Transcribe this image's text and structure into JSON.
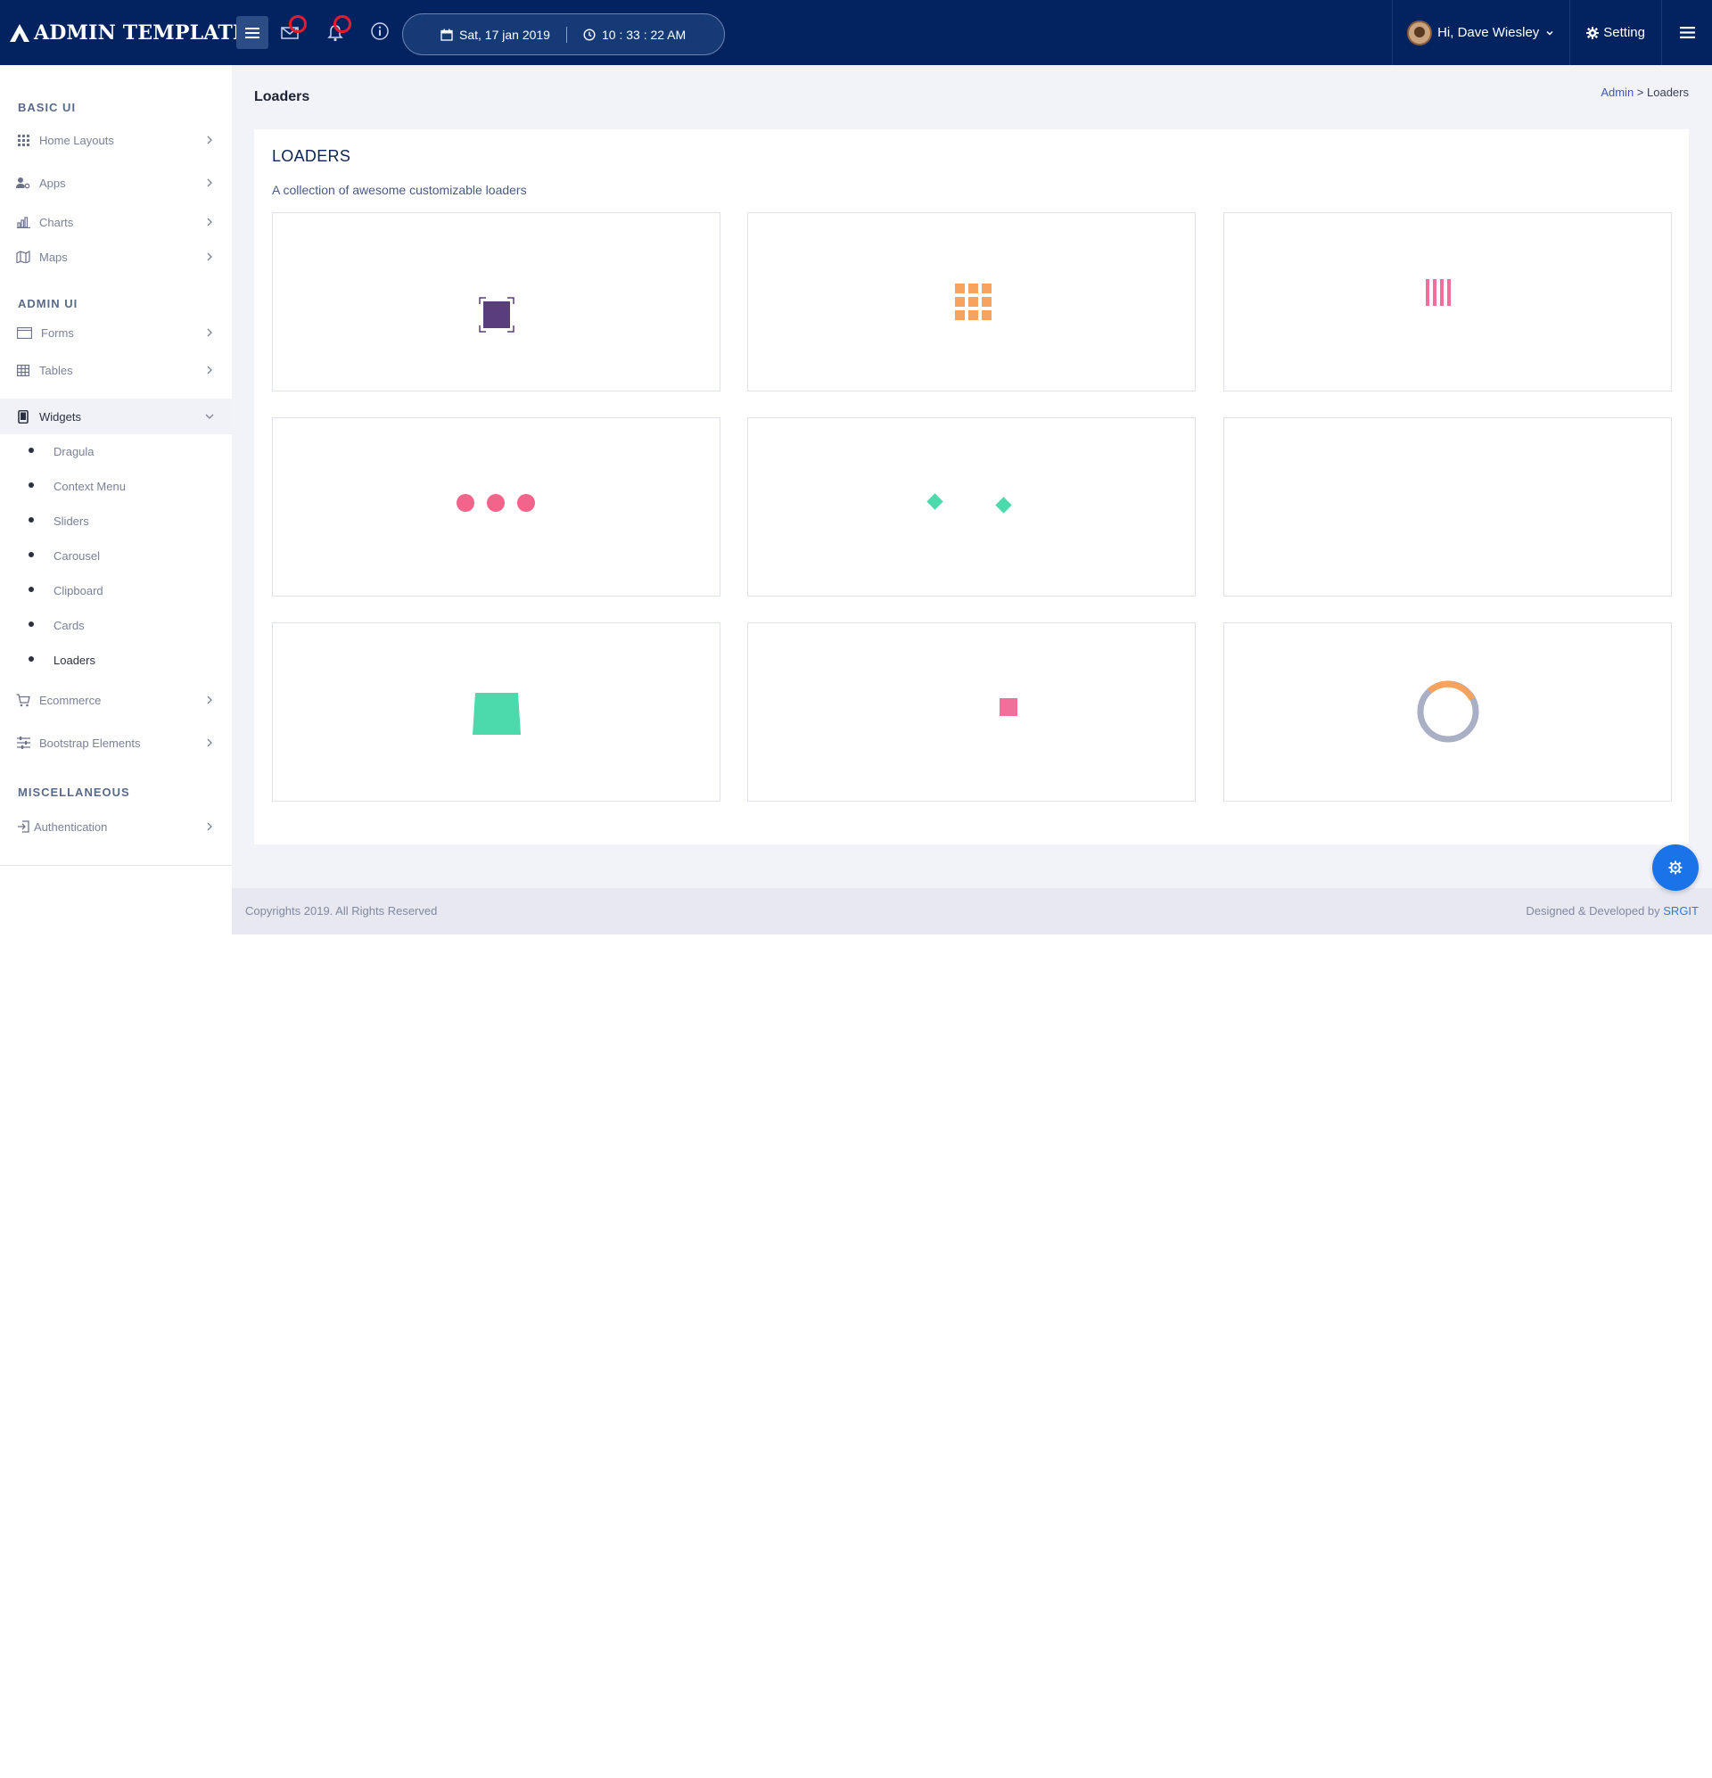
{
  "brand": {
    "name": "ADMIN TEMPLATE"
  },
  "topbar": {
    "date": "Sat, 17 jan 2019",
    "time": "10 : 33 : 22 AM",
    "user_greeting": "Hi, Dave Wiesley",
    "setting_label": "Setting"
  },
  "sidebar": {
    "sections": {
      "basic": "BASIC UI",
      "admin": "ADMIN UI",
      "misc": "MISCELLANEOUS"
    },
    "items": {
      "home_layouts": "Home Layouts",
      "apps": "Apps",
      "charts": "Charts",
      "maps": "Maps",
      "forms": "Forms",
      "tables": "Tables",
      "widgets": "Widgets",
      "ecommerce": "Ecommerce",
      "bootstrap": "Bootstrap Elements",
      "authentication": "Authentication"
    },
    "widgets_sub": [
      "Dragula",
      "Context Menu",
      "Sliders",
      "Carousel",
      "Clipboard",
      "Cards",
      "Loaders"
    ]
  },
  "main": {
    "page_title": "Loaders",
    "breadcrumb": {
      "root": "Admin",
      "sep": " > ",
      "current": "Loaders"
    },
    "card_title": "LOADERS",
    "card_subtitle": "A collection of awesome customizable loaders"
  },
  "footer": {
    "copyright": "Copyrights 2019. All Rights Reserved",
    "designed_by": "Designed & Developed by ",
    "designer": "SRGIT"
  },
  "colors": {
    "topbar": "#022360",
    "purple": "#5a3d7d",
    "orange": "#f7a25d",
    "pink": "#f0709b",
    "dot_pink": "#f3648a",
    "teal": "#4cd9ab",
    "ring_gray": "#a9afc4",
    "fab": "#1a73e8"
  }
}
